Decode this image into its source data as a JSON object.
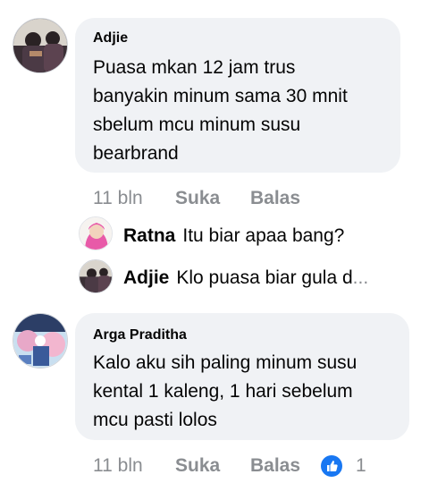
{
  "comments": [
    {
      "author": "Adjie",
      "text_lines": [
        "Puasa mkan 12 jam trus",
        "banyakin minum sama 30 mnit",
        "sbelum mcu minum susu",
        "bearbrand"
      ],
      "time": "11 bln",
      "like_label": "Suka",
      "reply_label": "Balas",
      "replies": [
        {
          "author": "Ratna",
          "text": "Itu biar apaa bang?"
        },
        {
          "author": "Adjie",
          "text": "Klo puasa biar gula d",
          "ellipsis": "..."
        }
      ]
    },
    {
      "author": "Arga Praditha",
      "text_lines": [
        "Kalo aku sih paling minum susu",
        "kental 1 kaleng, 1 hari sebelum",
        "mcu pasti lolos"
      ],
      "time": "11 bln",
      "like_label": "Suka",
      "reply_label": "Balas",
      "reaction_icon": "like-icon",
      "reaction_count": "1"
    }
  ],
  "colors": {
    "bubble": "#f0f2f5",
    "meta": "#8a8d91",
    "like_blue": "#1877f2"
  }
}
